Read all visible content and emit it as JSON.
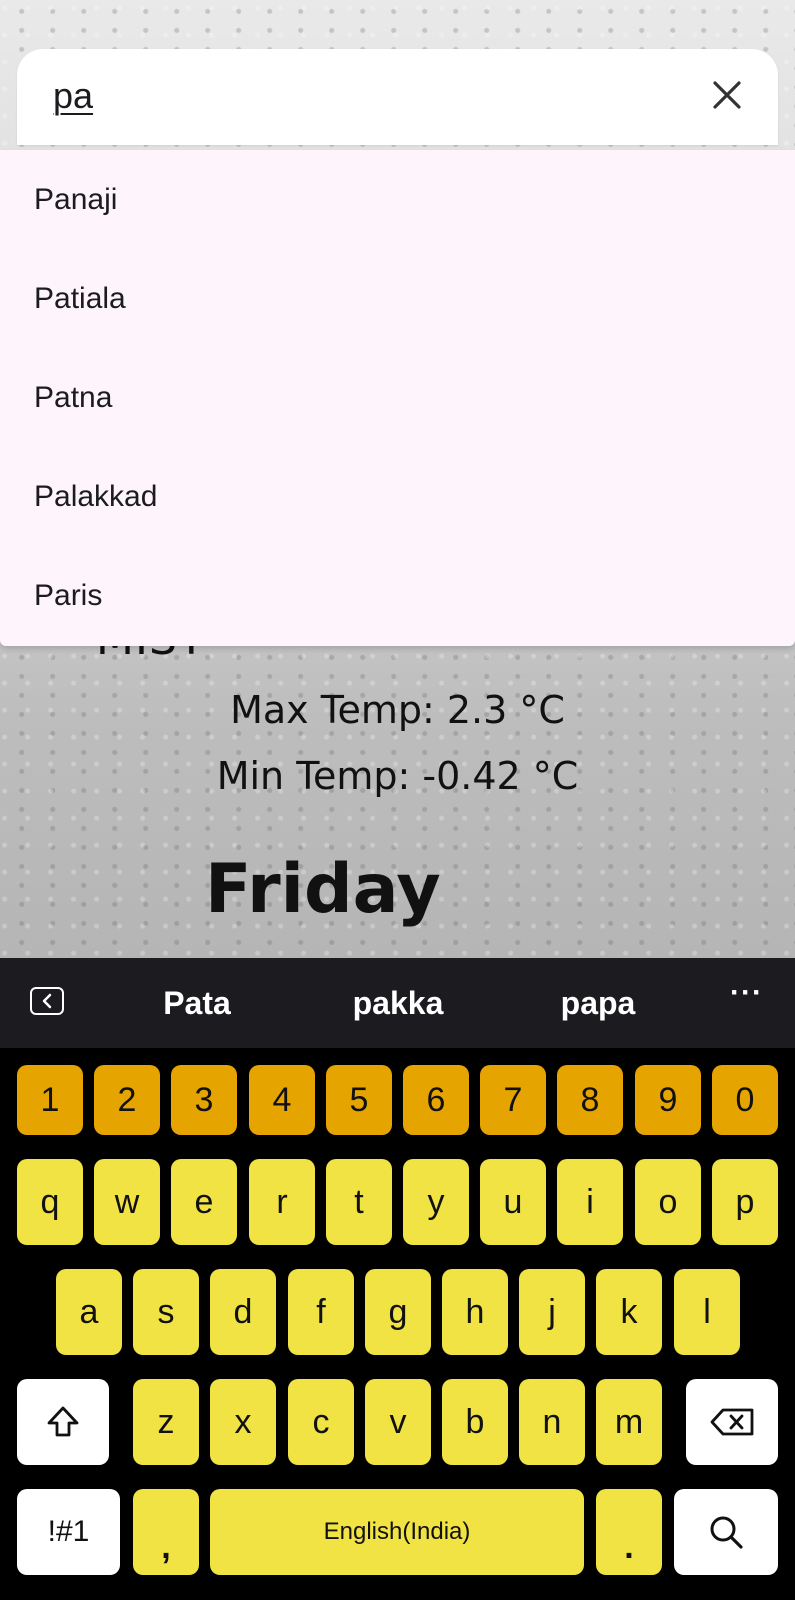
{
  "search": {
    "value": "pa"
  },
  "suggestions": [
    "Panaji",
    "Patiala",
    "Patna",
    "Palakkad",
    "Paris"
  ],
  "weather": {
    "condition": "MIST",
    "max_temp": "Max Temp: 2.3 °C",
    "min_temp": "Min Temp: -0.42 °C",
    "day": "Friday"
  },
  "keyboard": {
    "word_suggestions": [
      "Pata",
      "pakka",
      "papa"
    ],
    "more": "···",
    "numbers": [
      "1",
      "2",
      "3",
      "4",
      "5",
      "6",
      "7",
      "8",
      "9",
      "0"
    ],
    "row1": [
      "q",
      "w",
      "e",
      "r",
      "t",
      "y",
      "u",
      "i",
      "o",
      "p"
    ],
    "row2": [
      "a",
      "s",
      "d",
      "f",
      "g",
      "h",
      "j",
      "k",
      "l"
    ],
    "row3": [
      "z",
      "x",
      "c",
      "v",
      "b",
      "n",
      "m"
    ],
    "symbols_label": "!#1",
    "comma": ",",
    "space_label": "English(India)",
    "period": "."
  },
  "colors": {
    "number_key": "#e6a400",
    "letter_key": "#f0e343",
    "dropdown_bg": "#fdf4fc"
  }
}
